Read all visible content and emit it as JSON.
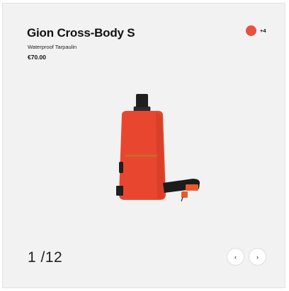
{
  "product": {
    "name": "Gion Cross-Body S",
    "material": "Waterproof Tarpaulin",
    "price": "€70.00",
    "image_alt": "orange-cross-body-bag"
  },
  "colors": {
    "selected_swatch": "#e8513f",
    "more_label": "+4"
  },
  "gallery": {
    "counter": "1 /12",
    "prev_icon": "chevron-left-icon",
    "next_icon": "chevron-right-icon",
    "prev_glyph": "‹",
    "next_glyph": "›"
  }
}
